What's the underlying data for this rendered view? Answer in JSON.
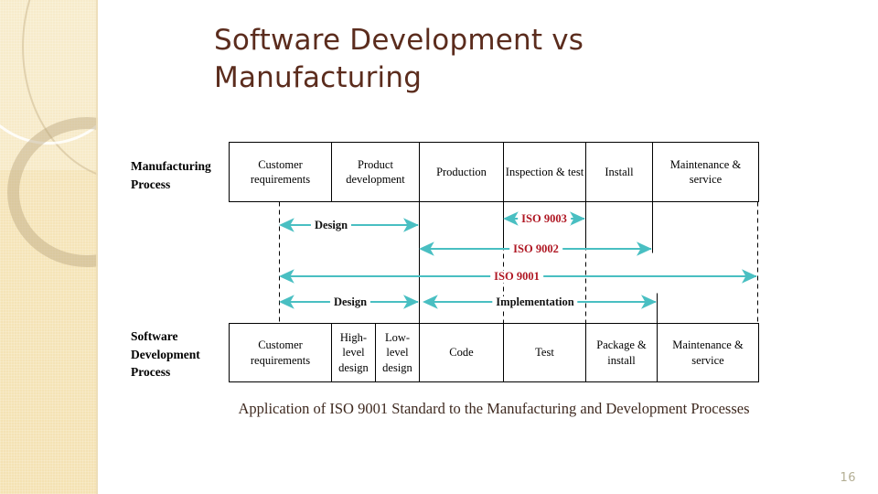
{
  "slide": {
    "title": "Software Development vs Manufacturing",
    "page_number": "16",
    "caption": "Application of ISO 9001 Standard to the Manufacturing and Development Processes"
  },
  "colors": {
    "title": "#5b2c1d",
    "arrow": "#49bfc2",
    "iso_label": "#b01824",
    "caption": "#3f2a20",
    "band": "#f5e4b8",
    "page_number": "#b3ae93"
  },
  "manufacturing": {
    "label": "Manufacturing Process",
    "stages": [
      {
        "text": "Customer requirements"
      },
      {
        "text": "Product development"
      },
      {
        "text": "Production"
      },
      {
        "text": "Inspection & test"
      },
      {
        "text": "Install"
      },
      {
        "text": "Maintenance & service"
      }
    ]
  },
  "software": {
    "label": "Software Development Process",
    "stages": [
      {
        "text": "Customer requirements"
      },
      {
        "text": "High-level design"
      },
      {
        "text": "Low-level design"
      },
      {
        "text": "Code"
      },
      {
        "text": "Test"
      },
      {
        "text": "Package & install"
      },
      {
        "text": "Maintenance & service"
      }
    ]
  },
  "spans": [
    {
      "name": "design-upper",
      "label": "Design",
      "style": "black"
    },
    {
      "name": "iso-9003",
      "label": "ISO 9003",
      "style": "red"
    },
    {
      "name": "iso-9002",
      "label": "ISO 9002",
      "style": "red"
    },
    {
      "name": "iso-9001",
      "label": "ISO 9001",
      "style": "red"
    },
    {
      "name": "design-lower",
      "label": "Design",
      "style": "black"
    },
    {
      "name": "implementation",
      "label": "Implementation",
      "style": "black"
    }
  ]
}
